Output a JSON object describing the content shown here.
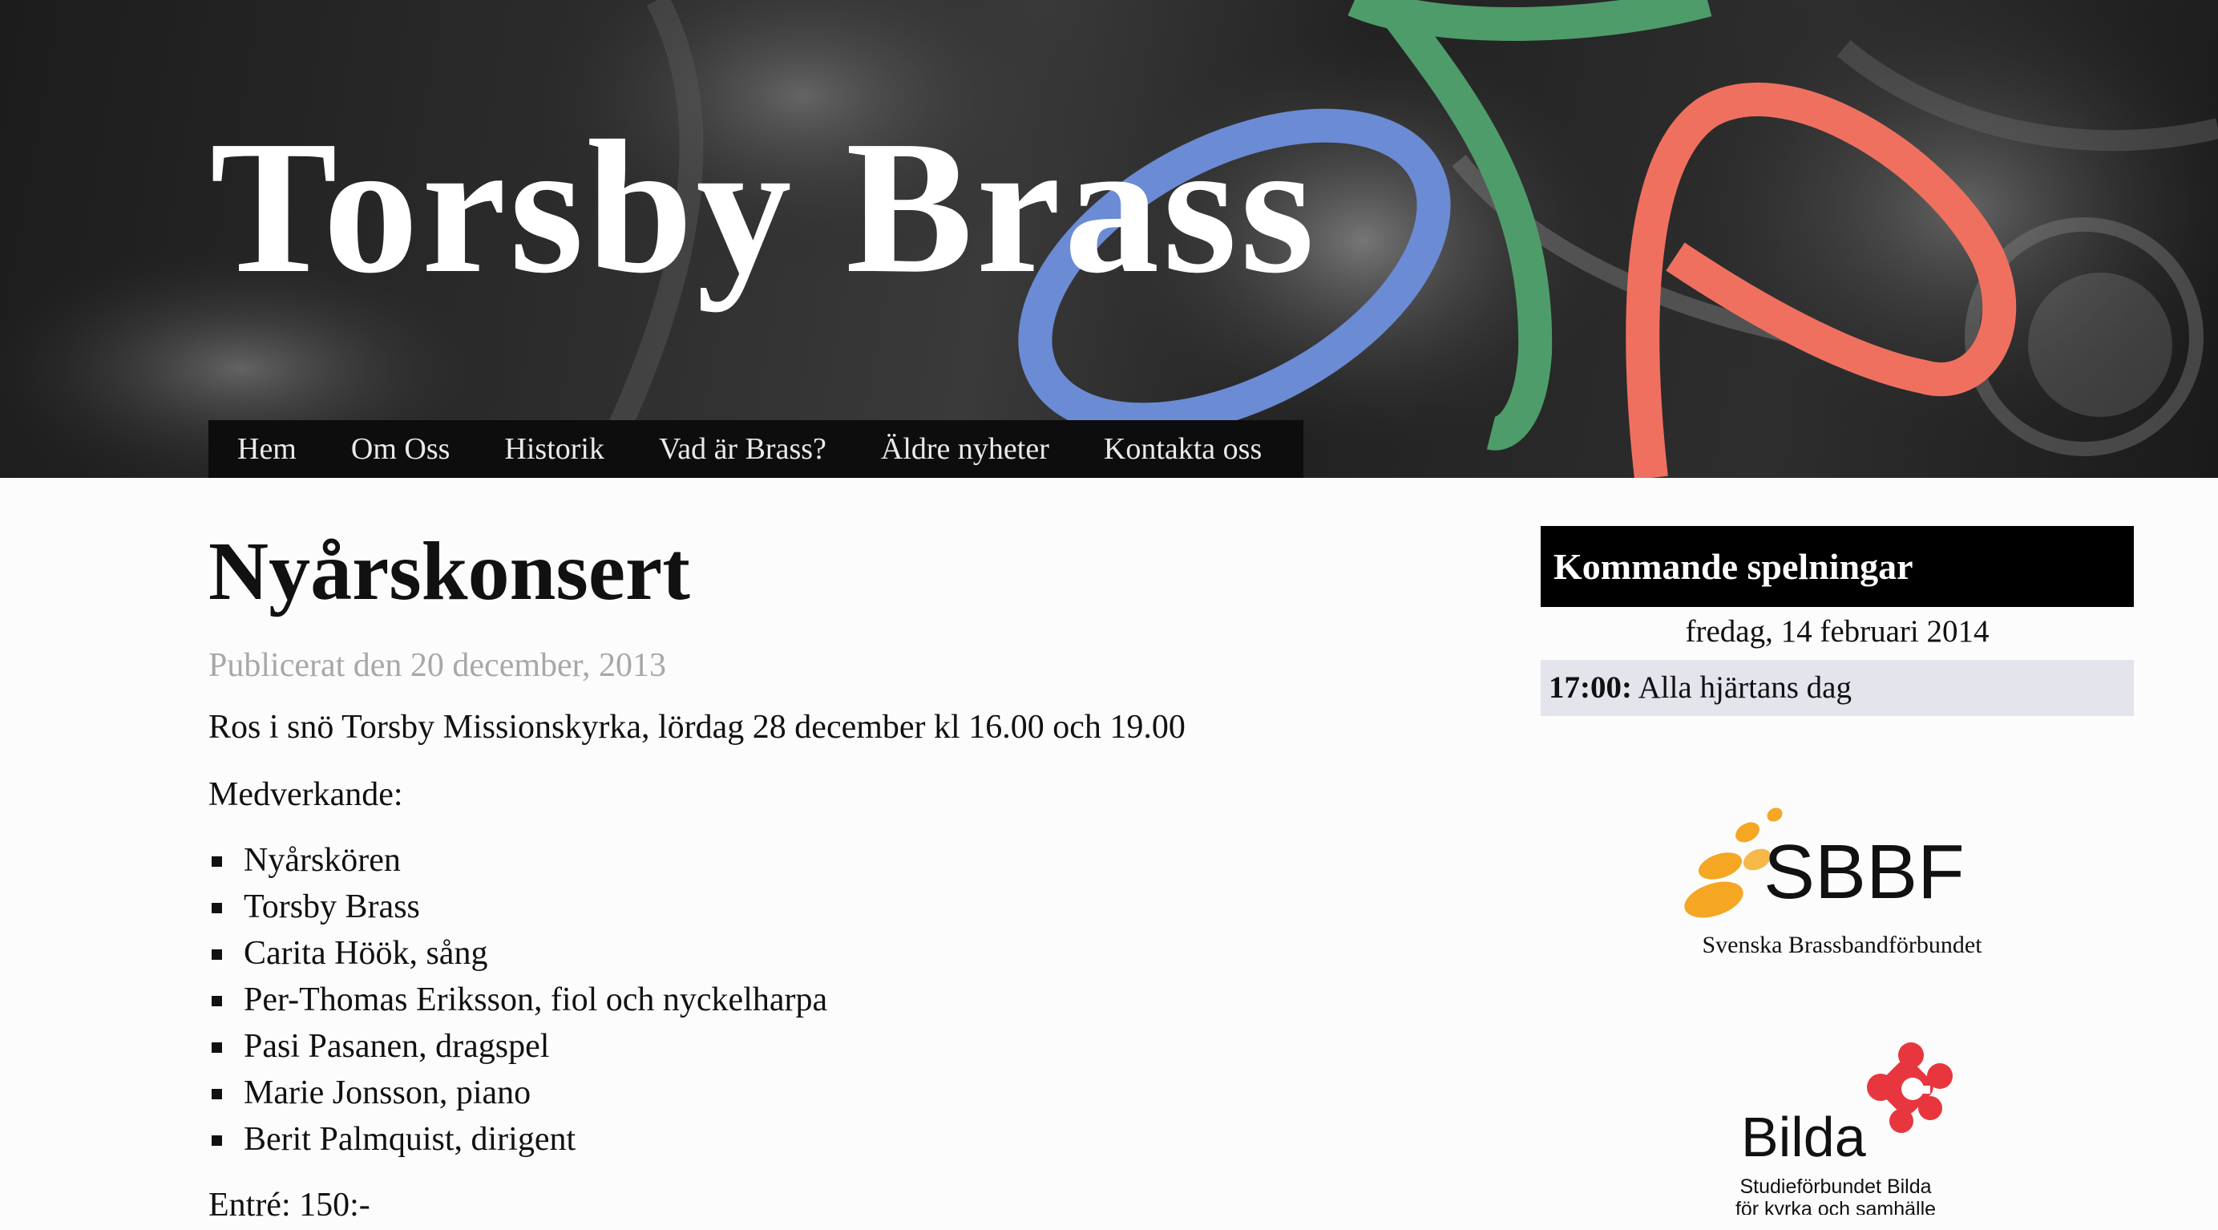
{
  "site": {
    "title": "Torsby Brass"
  },
  "nav": {
    "items": [
      {
        "label": "Hem"
      },
      {
        "label": "Om Oss"
      },
      {
        "label": "Historik"
      },
      {
        "label": "Vad är Brass?"
      },
      {
        "label": "Äldre nyheter"
      },
      {
        "label": "Kontakta oss"
      }
    ]
  },
  "post": {
    "title": "Nyårskonsert",
    "date": "Publicerat den 20 december, 2013",
    "intro": "Ros i snö Torsby Missionskyrka, lördag 28 december kl 16.00 och 19.00",
    "participants_label": "Medverkande:",
    "participants": [
      "Nyårskören",
      "Torsby Brass",
      "Carita Höök, sång",
      "Per-Thomas Eriksson, fiol och nyckelharpa",
      "Pasi Pasanen, dragspel",
      "Marie Jonsson, piano",
      "Berit Palmquist, dirigent"
    ],
    "entry": "Entré: 150:-"
  },
  "sidebar": {
    "widget_title": "Kommande spelningar",
    "events_date": "fredag, 14 februari 2014",
    "event_time": "17:00:",
    "event_name": " Alla hjärtans dag"
  },
  "logos": {
    "sbbf_text": "SBBF",
    "sbbf_caption": "Svenska Brassbandförbundet",
    "bilda_text": "Bilda",
    "bilda_caption_1": "Studieförbundet Bilda",
    "bilda_caption_2": "för kyrka och samhälle"
  },
  "colors": {
    "ring_blue": "#6b8bd4",
    "ring_green": "#4e9c6a",
    "ring_red": "#f07060",
    "nav_bg": "#0d0d0d",
    "date_grey": "#a8a8a8",
    "event_bg": "#e4e4ec",
    "sbbf_orange": "#f5a623",
    "bilda_red": "#e8363f"
  }
}
